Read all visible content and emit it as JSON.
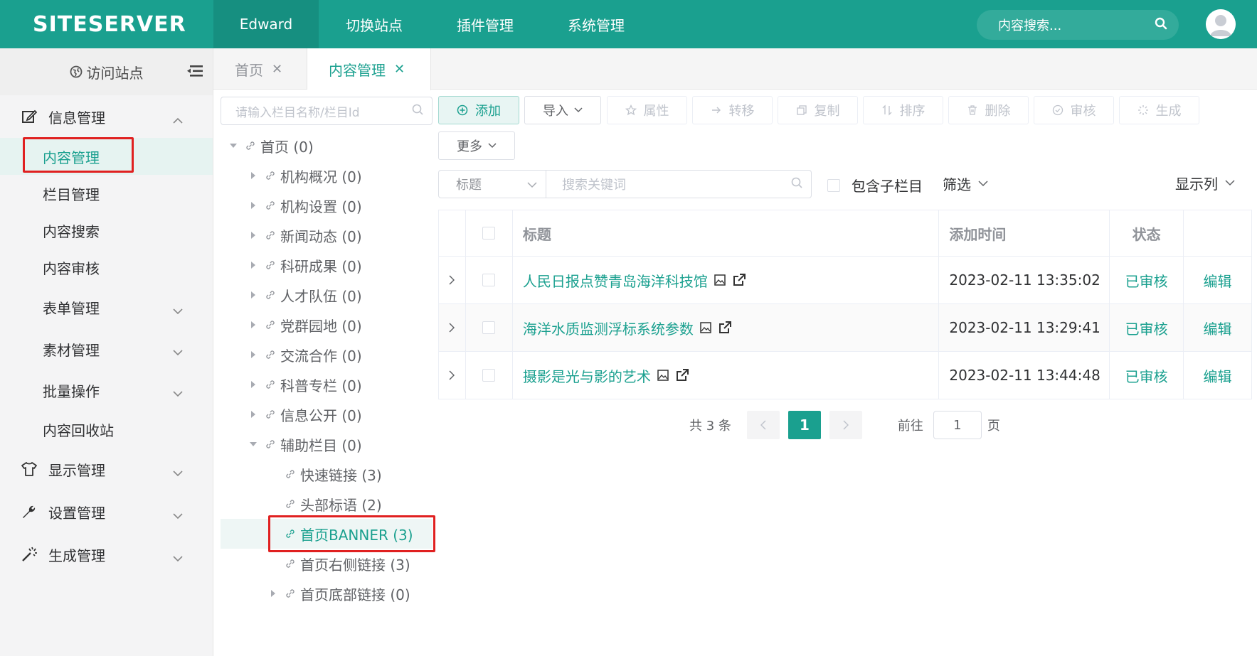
{
  "header": {
    "logo": "SITESERVER",
    "nav": [
      "Edward",
      "切换站点",
      "插件管理",
      "系统管理"
    ],
    "search_placeholder": "内容搜索..."
  },
  "sidebar": {
    "visit": "访问站点",
    "groups": [
      {
        "label": "信息管理",
        "icon": "edit-icon"
      },
      {
        "label": "显示管理",
        "icon": "tshirt-icon"
      },
      {
        "label": "设置管理",
        "icon": "wrench-icon"
      },
      {
        "label": "生成管理",
        "icon": "magic-wand-icon"
      }
    ],
    "items": [
      "内容管理",
      "栏目管理",
      "内容搜索",
      "内容审核",
      "表单管理",
      "素材管理",
      "批量操作",
      "内容回收站"
    ]
  },
  "tabs": [
    "首页",
    "内容管理"
  ],
  "tree": {
    "search_placeholder": "请输入栏目名称/栏目Id",
    "nodes": [
      "首页 (0)",
      "机构概况 (0)",
      "机构设置 (0)",
      "新闻动态 (0)",
      "科研成果 (0)",
      "人才队伍 (0)",
      "党群园地 (0)",
      "交流合作 (0)",
      "科普专栏 (0)",
      "信息公开 (0)",
      "辅助栏目 (0)",
      "快速链接 (3)",
      "头部标语 (2)",
      "首页BANNER (3)",
      "首页右侧链接 (3)",
      "首页底部链接 (0)"
    ]
  },
  "toolbar": {
    "add": "添加",
    "import": "导入",
    "attrs": "属性",
    "move": "转移",
    "copy": "复制",
    "sort": "排序",
    "delete": "删除",
    "audit": "审核",
    "generate": "生成",
    "more": "更多"
  },
  "filter": {
    "field": "标题",
    "keyword_placeholder": "搜索关键词",
    "include_children": "包含子栏目",
    "filter": "筛选",
    "columns": "显示列"
  },
  "table": {
    "headers": {
      "title": "标题",
      "time": "添加时间",
      "status": "状态"
    },
    "rows": [
      {
        "title": "人民日报点赞青岛海洋科技馆",
        "time": "2023-02-11 13:35:02",
        "status": "已审核",
        "action": "编辑"
      },
      {
        "title": "海洋水质监测浮标系统参数",
        "time": "2023-02-11 13:29:41",
        "status": "已审核",
        "action": "编辑"
      },
      {
        "title": "摄影是光与影的艺术",
        "time": "2023-02-11 13:44:48",
        "status": "已审核",
        "action": "编辑"
      }
    ]
  },
  "pager": {
    "total": "共 3 条",
    "current": "1",
    "goto": "前往",
    "goto_value": "1",
    "page_unit": "页"
  },
  "colors": {
    "accent": "#1aa08f",
    "highlight_border": "#e02020"
  }
}
